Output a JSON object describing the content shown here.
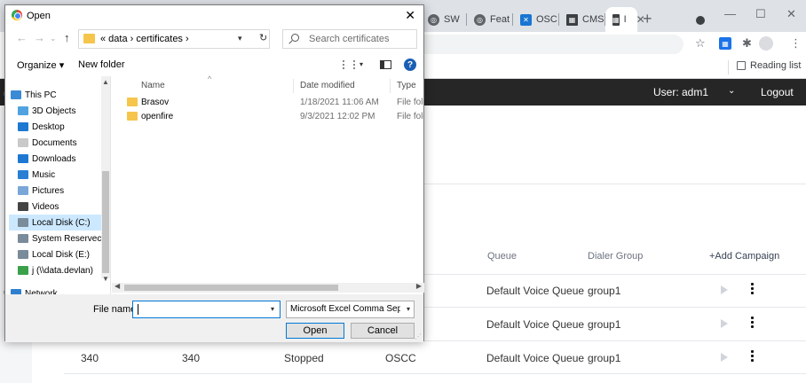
{
  "browser": {
    "tabs": [
      {
        "label": "SW"
      },
      {
        "label": "Feat"
      },
      {
        "label": "OSC"
      },
      {
        "label": "CMS"
      },
      {
        "label": "I"
      }
    ],
    "icons": [
      "globe-icon",
      "slack-icon",
      "qr-icon",
      "star-icon",
      "puzzle-icon",
      "profile-icon",
      "kebab-icon"
    ],
    "reading_list": "Reading list"
  },
  "app": {
    "user_label": "User:  adm1",
    "logout": "Logout",
    "columns": {
      "queue": "Queue",
      "dialer_group": "Dialer Group"
    },
    "add_campaign": "+Add Campaign",
    "rows": [
      {
        "queue": "Default Voice Queue",
        "group": "group1"
      },
      {
        "queue": "Default Voice Queue",
        "group": "group1"
      },
      {
        "id": "340",
        "name": "340",
        "status": "Stopped",
        "type": "OSCC",
        "queue": "Default Voice Queue",
        "group": "group1"
      }
    ]
  },
  "dialog": {
    "title": "Open",
    "path": "« data  ›  certificates  ›",
    "search_placeholder": "Search certificates",
    "organize": "Organize ▾",
    "new_folder": "New folder",
    "nav_items": [
      {
        "label": "This PC",
        "color": "#3b8ad6"
      },
      {
        "label": "3D Objects",
        "color": "#4fa3e0"
      },
      {
        "label": "Desktop",
        "color": "#1e78d2"
      },
      {
        "label": "Documents",
        "color": "#c9c9c9"
      },
      {
        "label": "Downloads",
        "color": "#1e78d2"
      },
      {
        "label": "Music",
        "color": "#2a7fd4"
      },
      {
        "label": "Pictures",
        "color": "#7aa7d8"
      },
      {
        "label": "Videos",
        "color": "#444444"
      },
      {
        "label": "Local Disk (C:)",
        "color": "#7a8b99"
      },
      {
        "label": "System Reservec",
        "color": "#7a8b99"
      },
      {
        "label": "Local Disk (E:)",
        "color": "#7a8b99"
      },
      {
        "label": "j (\\\\data.devlan)",
        "color": "#3aa14a"
      },
      {
        "label": "Network",
        "color": "#2f7fd0"
      }
    ],
    "selected_nav": "Local Disk (C:)",
    "columns": {
      "name": "Name",
      "date": "Date modified",
      "type": "Type"
    },
    "files": [
      {
        "name": "Brasov",
        "date": "1/18/2021 11:06 AM",
        "type": "File folder"
      },
      {
        "name": "openfire",
        "date": "9/3/2021 12:02 PM",
        "type": "File folder"
      }
    ],
    "file_name_label": "File name:",
    "file_name_value": "",
    "file_type": "Microsoft Excel Comma Separated",
    "open_button": "Open",
    "cancel_button": "Cancel"
  }
}
